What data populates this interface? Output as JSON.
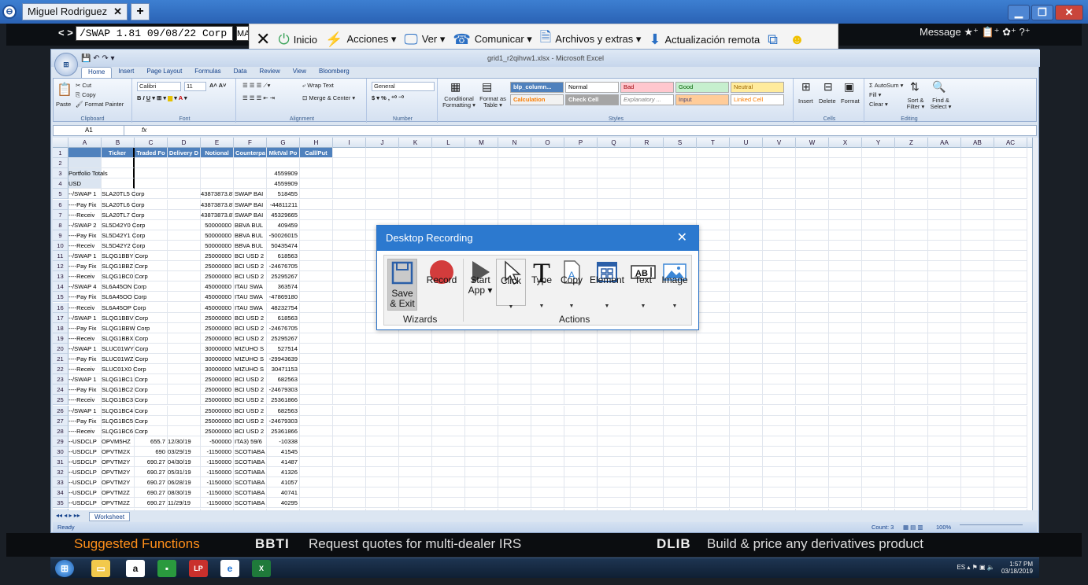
{
  "remote": {
    "tab_user": "Miguel Rodriguez",
    "tab_close": "✕",
    "tab_plus": "+"
  },
  "bloomberg": {
    "command": "/SWAP 1.81 09/08/22 Corp",
    "command_tail": "MA",
    "message": "Message ★⁺ 📋⁺ ✿⁺ ?⁺"
  },
  "remote_toolbar": {
    "items": [
      "Inicio",
      "Acciones ▾",
      "Ver ▾",
      "Comunicar ▾",
      "Archivos y extras ▾",
      "Actualización remota"
    ]
  },
  "excel": {
    "title": "grid1_r2qihvw1.xlsx - Microsoft Excel",
    "tabs": [
      "Home",
      "Insert",
      "Page Layout",
      "Formulas",
      "Data",
      "Review",
      "View",
      "Bloomberg"
    ],
    "ribbon": {
      "clipboard": {
        "paste": "Paste",
        "cut": "Cut",
        "copy": "Copy",
        "painter": "Format Painter",
        "label": "Clipboard"
      },
      "font": {
        "name": "Calibri",
        "size": "11",
        "label": "Font"
      },
      "alignment": {
        "wrap": "Wrap Text",
        "merge": "Merge & Center ▾",
        "label": "Alignment"
      },
      "number": {
        "format": "General",
        "label": "Number"
      },
      "styles": {
        "conditional": "Conditional Formatting ▾",
        "table": "Format as Table ▾",
        "cells_row1": [
          "blp_column...",
          "Normal",
          "Bad",
          "Good",
          "Neutral"
        ],
        "cells_row2": [
          "Calculation",
          "Check Cell",
          "Explanatory ...",
          "Input",
          "Linked Cell"
        ],
        "label": "Styles"
      },
      "cells": {
        "insert": "Insert",
        "delete": "Delete",
        "format": "Format",
        "label": "Cells"
      },
      "editing": {
        "autosum": "Σ AutoSum ▾",
        "fill": "Fill ▾",
        "clear": "Clear ▾",
        "sort": "Sort & Filter ▾",
        "find": "Find & Select ▾",
        "label": "Editing"
      }
    },
    "name_box": "A1",
    "fx": "fx",
    "columns": [
      "A",
      "B",
      "C",
      "D",
      "E",
      "F",
      "G",
      "H",
      "I",
      "J",
      "K",
      "L",
      "M",
      "N",
      "O",
      "P",
      "Q",
      "R",
      "S",
      "T",
      "U",
      "V",
      "W",
      "X",
      "Y",
      "Z",
      "AA",
      "AB",
      "AC"
    ],
    "rows": [
      [
        "",
        "Ticker",
        "Traded Fo",
        "Delivery D",
        "Notional",
        "Counterpa",
        "MktVal Po",
        "Call/Put"
      ],
      [
        "",
        "",
        "",
        "",
        "",
        "",
        "",
        ""
      ],
      [
        "Portfolio Totals",
        "",
        "",
        "",
        "",
        "",
        "4559909",
        ""
      ],
      [
        "USD",
        "",
        "",
        "",
        "",
        "",
        "4559909",
        ""
      ],
      [
        "--/SWAP 1",
        "SLA20TL5 Corp",
        "",
        "",
        "43873873.87",
        "SWAP BAI",
        "518455",
        ""
      ],
      [
        "----Pay Fix",
        "SLA20TL6 Corp",
        "",
        "",
        "43873873.87",
        "SWAP BAI",
        "-44811211",
        ""
      ],
      [
        "----Receiv",
        "SLA20TL7 Corp",
        "",
        "",
        "43873873.87",
        "SWAP BAI",
        "45329665",
        ""
      ],
      [
        "--/SWAP 2",
        "SL5D42Y0 Corp",
        "",
        "",
        "50000000",
        "BBVA BUL",
        "409459",
        ""
      ],
      [
        "----Pay Fix",
        "SL5D42Y1 Corp",
        "",
        "",
        "50000000",
        "BBVA BUL",
        "-50026015",
        ""
      ],
      [
        "----Receiv",
        "SL5D42Y2 Corp",
        "",
        "",
        "50000000",
        "BBVA BUL",
        "50435474",
        ""
      ],
      [
        "--/SWAP 1",
        "SLQG1BBY Corp",
        "",
        "",
        "25000000",
        "BCI USD 2",
        "618563",
        ""
      ],
      [
        "----Pay Fix",
        "SLQG1BBZ Corp",
        "",
        "",
        "25000000",
        "BCI USD 2",
        "-24676705",
        ""
      ],
      [
        "----Receiv",
        "SLQG1BC0 Corp",
        "",
        "",
        "25000000",
        "BCI USD 2",
        "25295267",
        ""
      ],
      [
        "--/SWAP 4",
        "SL6A45ON Corp",
        "",
        "",
        "45000000",
        "ITAU SWA",
        "363574",
        ""
      ],
      [
        "----Pay Fix",
        "SL6A45OO Corp",
        "",
        "",
        "45000000",
        "ITAU SWA",
        "-47869180",
        ""
      ],
      [
        "----Receiv",
        "SL6A45OP Corp",
        "",
        "",
        "45000000",
        "ITAU SWA",
        "48232754",
        ""
      ],
      [
        "--/SWAP 1",
        "SLQG1BBV Corp",
        "",
        "",
        "25000000",
        "BCI USD 2",
        "618563",
        ""
      ],
      [
        "----Pay Fix",
        "SLQG1BBW Corp",
        "",
        "",
        "25000000",
        "BCI USD 2",
        "-24676705",
        ""
      ],
      [
        "----Receiv",
        "SLQG1BBX Corp",
        "",
        "",
        "25000000",
        "BCI USD 2",
        "25295267",
        ""
      ],
      [
        "--/SWAP 1",
        "SLUC01WY Corp",
        "",
        "",
        "30000000",
        "MIZUHO S",
        "527514",
        ""
      ],
      [
        "----Pay Fix",
        "SLUC01WZ Corp",
        "",
        "",
        "30000000",
        "MIZUHO S",
        "-29943639",
        ""
      ],
      [
        "----Receiv",
        "SLUC01X0 Corp",
        "",
        "",
        "30000000",
        "MIZUHO S",
        "30471153",
        ""
      ],
      [
        "--/SWAP 1",
        "SLQG1BC1 Corp",
        "",
        "",
        "25000000",
        "BCI USD 2",
        "682563",
        ""
      ],
      [
        "----Pay Fix",
        "SLQG1BC2 Corp",
        "",
        "",
        "25000000",
        "BCI USD 2",
        "-24679303",
        ""
      ],
      [
        "----Receiv",
        "SLQG1BC3 Corp",
        "",
        "",
        "25000000",
        "BCI USD 2",
        "25361866",
        ""
      ],
      [
        "--/SWAP 1",
        "SLQG1BC4 Corp",
        "",
        "",
        "25000000",
        "BCI USD 2",
        "682563",
        ""
      ],
      [
        "----Pay Fix",
        "SLQG1BC5 Corp",
        "",
        "",
        "25000000",
        "BCI USD 2",
        "-24679303",
        ""
      ],
      [
        "----Receiv",
        "SLQG1BC6 Corp",
        "",
        "",
        "25000000",
        "BCI USD 2",
        "25361866",
        ""
      ],
      [
        "--USDCLP",
        "OPVM5HZ",
        "655.7",
        "12/30/19",
        "-500000",
        "ITA3) 59/6",
        "-10338",
        ""
      ],
      [
        "--USDCLP",
        "OPVTM2X",
        "690",
        "03/29/19",
        "-1150000",
        "SCOTIABA",
        "41545",
        ""
      ],
      [
        "--USDCLP",
        "OPVTM2Y",
        "690.27",
        "04/30/19",
        "-1150000",
        "SCOTIABA",
        "41487",
        ""
      ],
      [
        "--USDCLP",
        "OPVTM2Y",
        "690.27",
        "05/31/19",
        "-1150000",
        "SCOTIABA",
        "41326",
        ""
      ],
      [
        "--USDCLP",
        "OPVTM2Y",
        "690.27",
        "06/28/19",
        "-1150000",
        "SCOTIABA",
        "41057",
        ""
      ],
      [
        "--USDCLP",
        "OPVTM2Z",
        "690.27",
        "08/30/19",
        "-1150000",
        "SCOTIABA",
        "40741",
        ""
      ],
      [
        "--USDCLP",
        "OPVTM2Z",
        "690.27",
        "11/29/19",
        "-1150000",
        "SCOTIABA",
        "40295",
        ""
      ]
    ],
    "sheet_tab": "Worksheet",
    "status_ready": "Ready",
    "status_count": "Count: 3",
    "zoom": "100%"
  },
  "recorder": {
    "title": "Desktop Recording",
    "close": "✕",
    "tools": [
      {
        "label": "Save\n& Exit"
      },
      {
        "label": "Record"
      },
      {
        "label": "Start\nApp ▾"
      },
      {
        "label": "Click"
      },
      {
        "label": "Type"
      },
      {
        "label": "Copy"
      },
      {
        "label": "Element"
      },
      {
        "label": "Text"
      },
      {
        "label": "Image"
      }
    ],
    "wizards_label": "Wizards",
    "actions_label": "Actions"
  },
  "footer": {
    "suggested": "Suggested Functions",
    "k1": "BBTI",
    "d1": "Request quotes for multi-dealer IRS",
    "k2": "DLIB",
    "d2": "Build & price any derivatives product"
  },
  "taskbar": {
    "lang": "ES",
    "time": "1:57 PM",
    "date": "03/18/2019"
  }
}
